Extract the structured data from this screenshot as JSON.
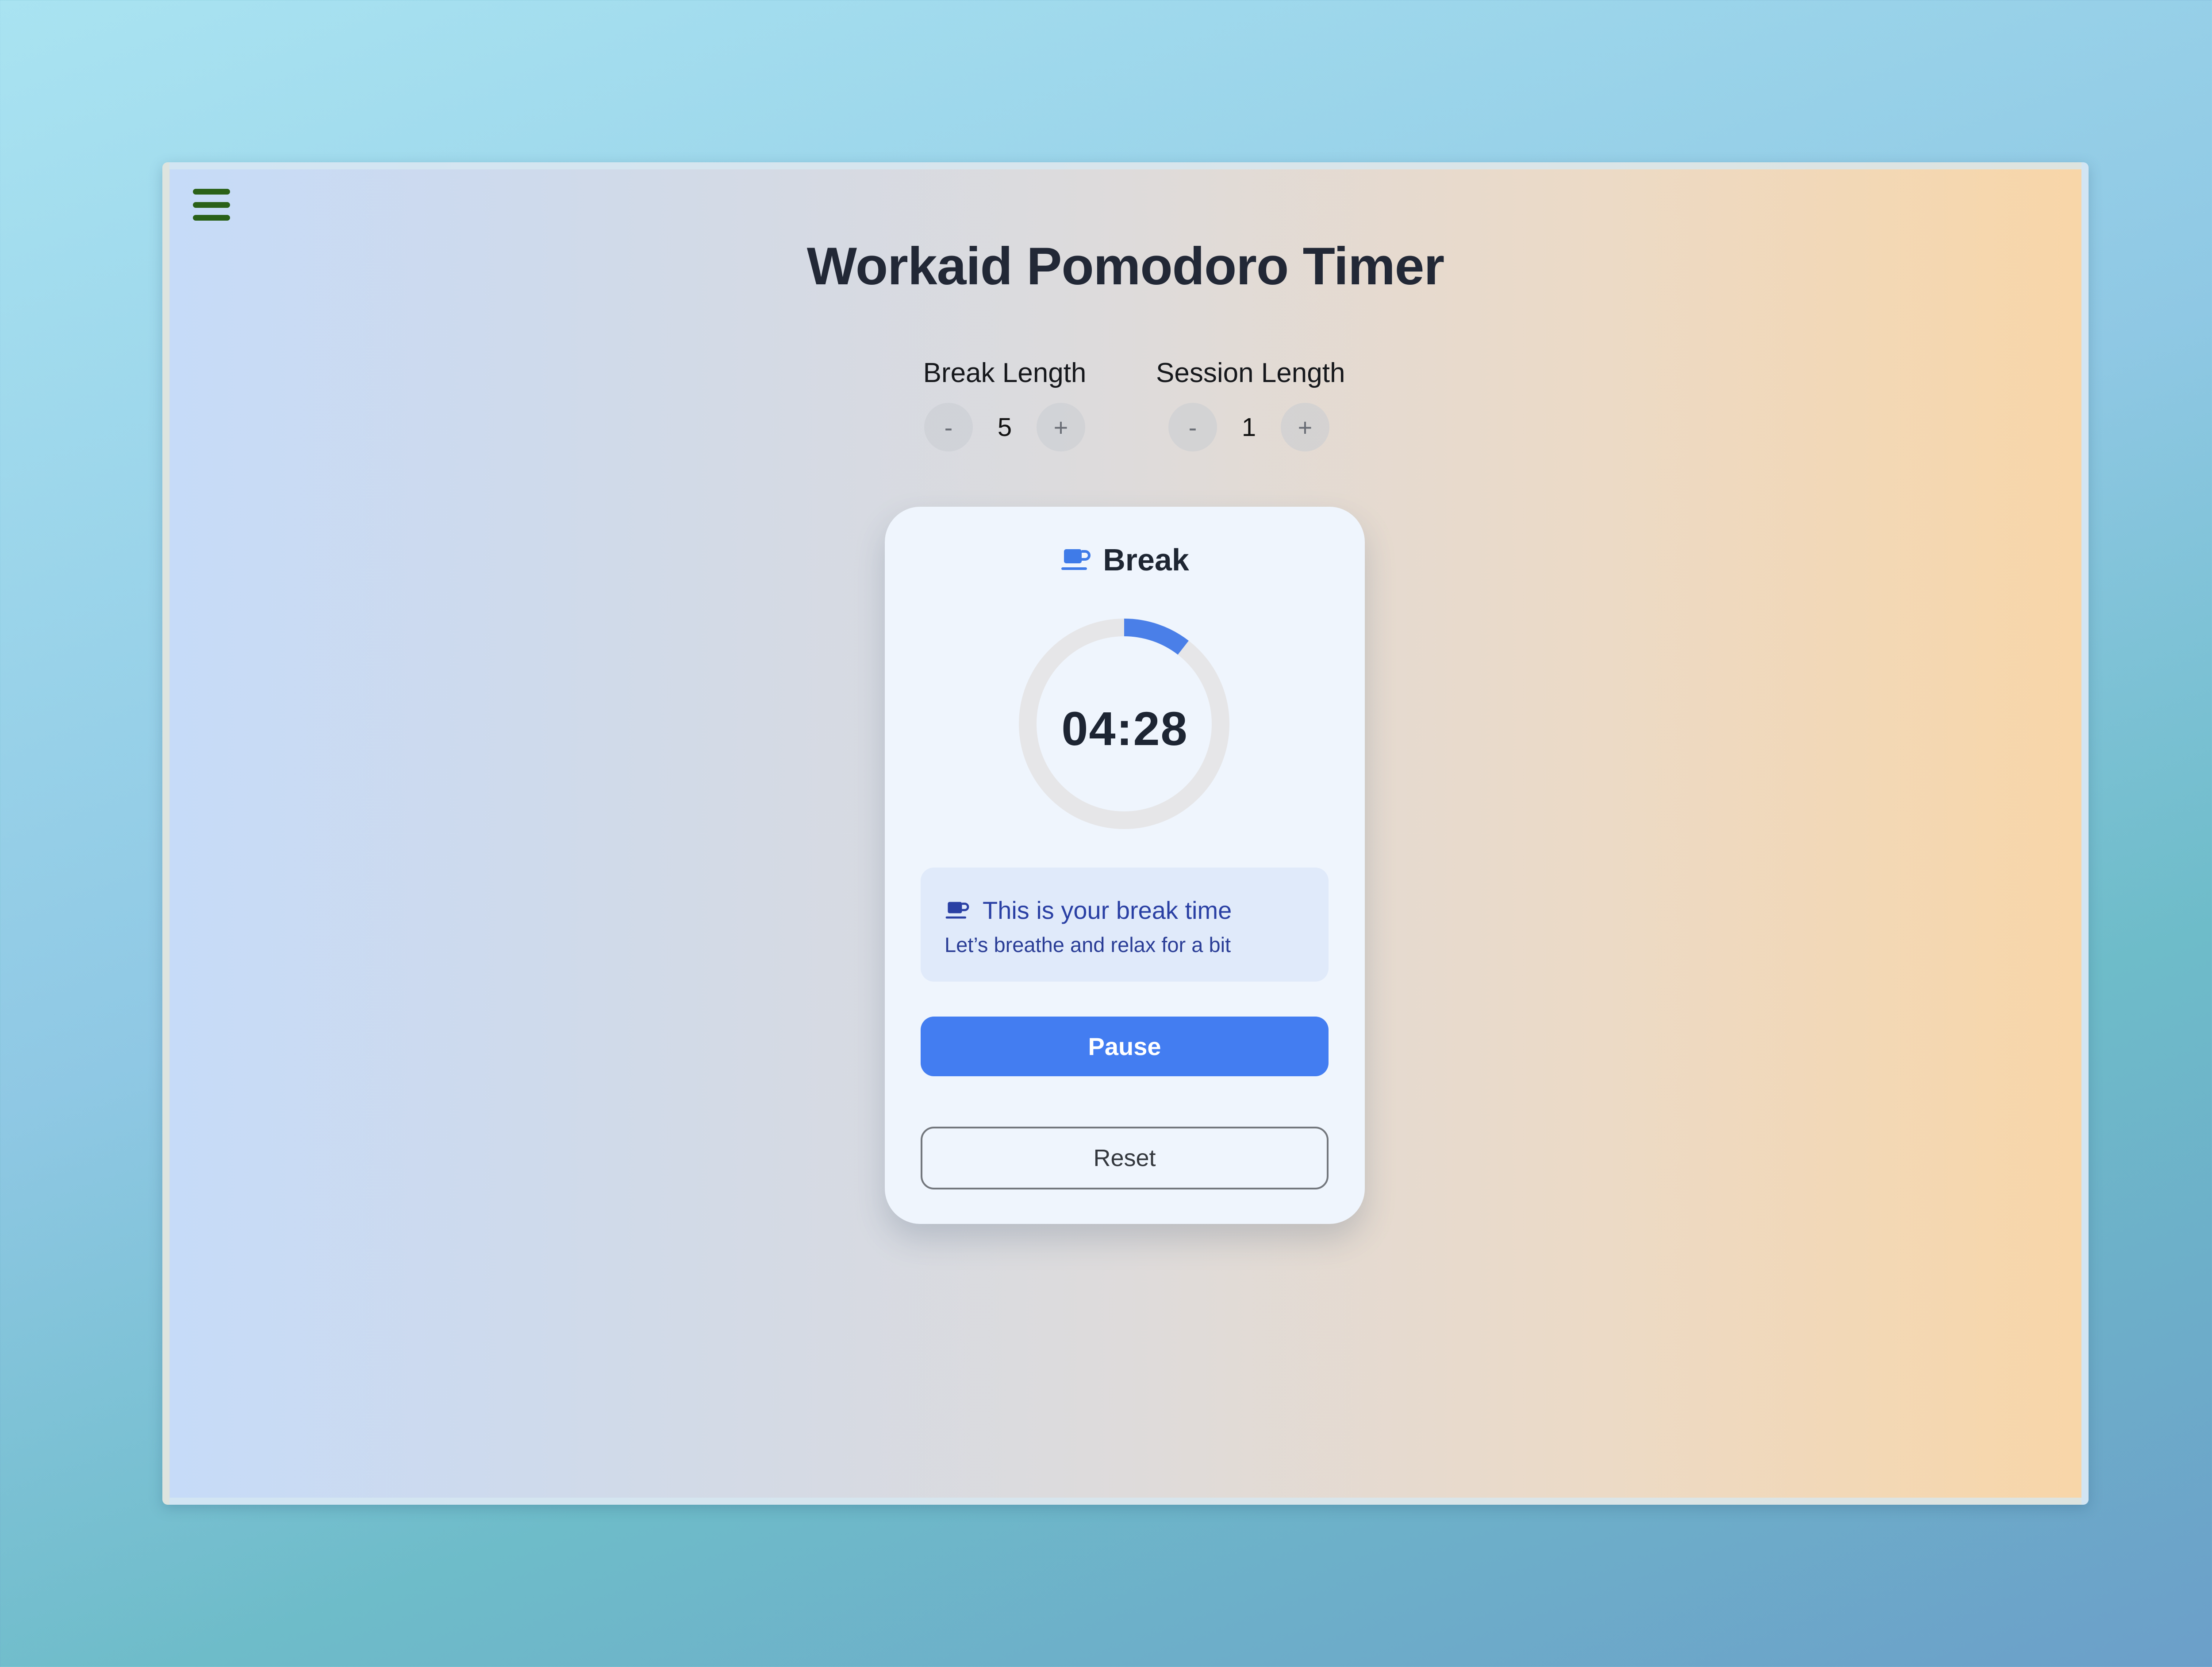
{
  "app": {
    "title": "Workaid Pomodoro Timer"
  },
  "menu": {
    "icon": "hamburger-menu-icon",
    "color": "#2a6118"
  },
  "controls": {
    "break": {
      "label": "Break Length",
      "decrement_label": "-",
      "value": "5",
      "increment_label": "+"
    },
    "session": {
      "label": "Session Length",
      "decrement_label": "-",
      "value": "1",
      "increment_label": "+"
    }
  },
  "timer": {
    "mode_icon": "coffee-cup-icon",
    "mode_label": "Break",
    "time": "04:28",
    "progress_fraction": 0.105,
    "progress_color": "#4a7fe8",
    "track_color": "#e6e6e8"
  },
  "message": {
    "icon": "coffee-cup-icon",
    "title": "This is your break time",
    "subtitle": "Let’s breathe and relax for a bit"
  },
  "buttons": {
    "pause_label": "Pause",
    "reset_label": "Reset",
    "accent_color": "#437df1"
  }
}
